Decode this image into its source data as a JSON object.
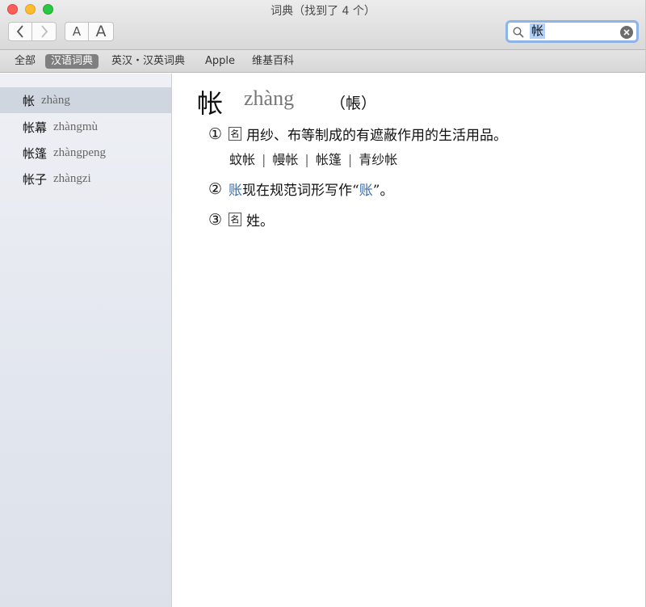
{
  "window": {
    "title": "词典（找到了 4 个）"
  },
  "toolbar": {
    "font_small_label": "A",
    "font_large_label": "A"
  },
  "search": {
    "value": "帐"
  },
  "scopes": [
    {
      "label": "全部"
    },
    {
      "label": "汉语词典"
    },
    {
      "label": "英汉・汉英词典"
    },
    {
      "label": "Apple"
    },
    {
      "label": "维基百科"
    }
  ],
  "active_scope": "汉语词典",
  "sidebar": {
    "entries": [
      {
        "word": "帐",
        "pinyin": "zhàng"
      },
      {
        "word": "帐幕",
        "pinyin": "zhàngmù"
      },
      {
        "word": "帐篷",
        "pinyin": "zhàngpeng"
      },
      {
        "word": "帐子",
        "pinyin": "zhàngzi"
      }
    ]
  },
  "entry": {
    "headword": "帐",
    "pinyin": "zhàng",
    "variant": "（帳）",
    "senses": [
      {
        "number": "①",
        "pos": "名",
        "text": "用纱、布等制成的有遮蔽作用的生活用品。",
        "examples": [
          "蚊帐",
          "幔帐",
          "帐篷",
          "青纱帐"
        ]
      },
      {
        "number": "②",
        "link": "账",
        "text_before_ref": "现在规范词形写作“",
        "ref": "账",
        "text_after_ref": "”。"
      },
      {
        "number": "③",
        "pos": "名",
        "text": "姓。"
      }
    ]
  },
  "colors": {
    "link": "#3f6fa6",
    "search_focus": "#8db4e8",
    "scope_active": "#7f7f7f",
    "sidebar_selected": "#d0d6df"
  }
}
